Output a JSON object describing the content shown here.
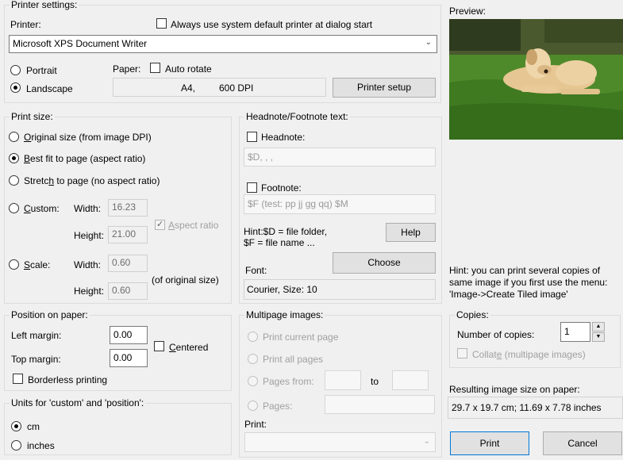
{
  "printer": {
    "title": "Printer settings:",
    "printer_label": "Printer:",
    "always_default_label": "Always use system default printer at dialog start",
    "selected_printer": "Microsoft XPS Document Writer",
    "portrait_label": "Portrait",
    "landscape_label": "Landscape",
    "paper_label": "Paper:",
    "auto_rotate_label": "Auto rotate",
    "paper_size": "A4,",
    "dpi": "600 DPI",
    "setup_button": "Printer setup"
  },
  "preview": {
    "title": "Preview:"
  },
  "print_size": {
    "title": "Print size:",
    "original_pre": "",
    "original_u": "O",
    "original_post": "riginal size (from image DPI)",
    "bestfit_u": "B",
    "bestfit_post": "est fit to page (aspect ratio)",
    "stretch_pre": "Stretc",
    "stretch_u": "h",
    "stretch_post": " to page (no aspect ratio)",
    "custom_u": "C",
    "custom_post": "ustom:",
    "width_label": "Width:",
    "height_label": "Height:",
    "custom_width": "16.23",
    "custom_height": "21.00",
    "aspect_u": "A",
    "aspect_post": "spect ratio",
    "scale_u": "S",
    "scale_post": "cale:",
    "scale_width": "0.60",
    "scale_height": "0.60",
    "of_original": "(of original size)"
  },
  "headnote": {
    "title": "Headnote/Footnote text:",
    "headnote_label": "Headnote:",
    "headnote_value": "$D, , ,",
    "footnote_label": "Footnote:",
    "footnote_value": "$F (test: pp jj gg qq) $M",
    "hint_line1": "Hint:$D = file folder,",
    "hint_line2": "$F = file name ...",
    "help_button": "Help",
    "font_label": "Font:",
    "choose_button": "Choose",
    "font_value": "Courier, Size: 10"
  },
  "hint": {
    "line1": "Hint: you can print several copies of",
    "line2": "same image if you first use the menu:",
    "line3": "'Image->Create Tiled image'"
  },
  "copies": {
    "title": "Copies:",
    "number_label": "Number of copies:",
    "value": "1",
    "collate_pre": "Collat",
    "collate_u": "e",
    "collate_post": " (multipage images)"
  },
  "position": {
    "title": "Position on paper:",
    "left_label": "Left margin:",
    "left_value": "0.00",
    "top_label": "Top margin:",
    "top_value": "0.00",
    "centered_u": "C",
    "centered_post": "entered",
    "borderless_label": "Borderless printing"
  },
  "units": {
    "title": "Units for 'custom' and 'position':",
    "cm_label": "cm",
    "inches_label": "inches"
  },
  "multipage": {
    "title": "Multipage images:",
    "current_label": "Print current page",
    "all_label": "Print all pages",
    "from_label": "Pages from:",
    "to_label": "to",
    "pages_label": "Pages:",
    "print_label": "Print:"
  },
  "result": {
    "title": "Resulting image size on paper:",
    "value": "29.7 x 19.7 cm; 11.69 x 7.78 inches"
  },
  "actions": {
    "print": "Print",
    "cancel": "Cancel"
  }
}
